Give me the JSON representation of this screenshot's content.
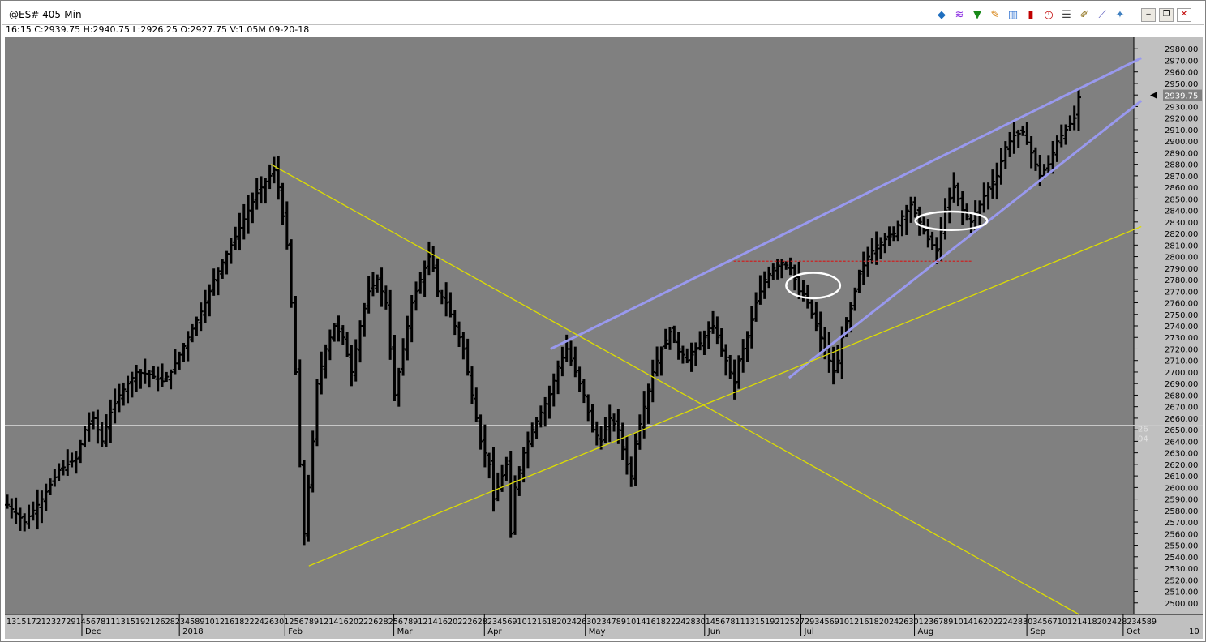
{
  "window": {
    "title": "@ES# 405-Min",
    "quote": "16:15  C:2939.75  H:2940.75  L:2926.25  O:2927.75  V:1.05M  09-20-18",
    "toolbar_icons": [
      "data-window-icon",
      "indicator-icon",
      "filter-icon",
      "drawing-pencil-icon",
      "bar-chart-icon",
      "candlestick-icon",
      "clock-icon",
      "format-icon",
      "pen-icon",
      "trendline-icon",
      "pin-icon"
    ],
    "toolbar_glyphs": [
      "◆",
      "≋",
      "▼",
      "✎",
      "▥",
      "▮",
      "◷",
      "☰",
      "✐",
      "⟋",
      "✦"
    ],
    "buttons": {
      "minimize": "‒",
      "restore": "❐",
      "close": "✕"
    }
  },
  "chart_data": {
    "type": "bar",
    "symbol": "@ES#",
    "interval": "405-Min",
    "ylim": [
      2490,
      2990
    ],
    "y_ticks": [
      "2980.00",
      "2970.00",
      "2960.00",
      "2950.00",
      "2940.00",
      "2930.00",
      "2920.00",
      "2910.00",
      "2900.00",
      "2890.00",
      "2880.00",
      "2870.00",
      "2860.00",
      "2850.00",
      "2840.00",
      "2830.00",
      "2820.00",
      "2810.00",
      "2800.00",
      "2790.00",
      "2780.00",
      "2770.00",
      "2760.00",
      "2750.00",
      "2740.00",
      "2730.00",
      "2720.00",
      "2710.00",
      "2700.00",
      "2690.00",
      "2680.00",
      "2670.00",
      "2660.00",
      "2650.00",
      "2640.00",
      "2630.00",
      "2620.00",
      "2610.00",
      "2600.00",
      "2590.00",
      "2580.00",
      "2570.00",
      "2560.00",
      "2550.00",
      "2540.00",
      "2530.00",
      "2520.00",
      "2510.00",
      "2500.00"
    ],
    "last_price_label": "2939.75",
    "crosshair_label_top": "26",
    "crosshair_label_bottom": "04",
    "crosshair_price": 2654,
    "x_day_ticks": "1315172123272914567811131519212628234589101216182224263012567891214162022262825678912141620222628234569101216182024263023478910141618222428301456781113151921252729345691012161820242630123678910141620222428303456710121418202428234589",
    "x_tail_ticks": "10",
    "month_labels": [
      "Dec",
      "2018",
      "Feb",
      "Mar",
      "Apr",
      "May",
      "Jun",
      "Jul",
      "Aug",
      "Sep",
      "Oct"
    ],
    "month_label_x_fracs": [
      0.07,
      0.155,
      0.247,
      0.342,
      0.421,
      0.509,
      0.613,
      0.697,
      0.796,
      0.894,
      0.978
    ],
    "bars_ohlc_anchor_path": [
      [
        0,
        2585
      ],
      [
        4,
        2570
      ],
      [
        8,
        2590
      ],
      [
        12,
        2615
      ],
      [
        16,
        2625
      ],
      [
        18,
        2650
      ],
      [
        20,
        2660
      ],
      [
        22,
        2640
      ],
      [
        24,
        2665
      ],
      [
        26,
        2680
      ],
      [
        28,
        2690
      ],
      [
        30,
        2700
      ],
      [
        33,
        2698
      ],
      [
        36,
        2692
      ],
      [
        38,
        2700
      ],
      [
        40,
        2715
      ],
      [
        42,
        2730
      ],
      [
        44,
        2745
      ],
      [
        46,
        2760
      ],
      [
        48,
        2780
      ],
      [
        50,
        2795
      ],
      [
        52,
        2810
      ],
      [
        54,
        2825
      ],
      [
        56,
        2840
      ],
      [
        58,
        2855
      ],
      [
        60,
        2865
      ],
      [
        62,
        2875
      ],
      [
        63,
        2860
      ],
      [
        64,
        2835
      ],
      [
        65,
        2810
      ],
      [
        66,
        2760
      ],
      [
        67,
        2700
      ],
      [
        68,
        2620
      ],
      [
        69,
        2560
      ],
      [
        70,
        2600
      ],
      [
        71,
        2640
      ],
      [
        72,
        2690
      ],
      [
        74,
        2720
      ],
      [
        76,
        2740
      ],
      [
        78,
        2730
      ],
      [
        80,
        2700
      ],
      [
        82,
        2740
      ],
      [
        84,
        2770
      ],
      [
        86,
        2780
      ],
      [
        88,
        2760
      ],
      [
        90,
        2680
      ],
      [
        92,
        2720
      ],
      [
        94,
        2760
      ],
      [
        96,
        2780
      ],
      [
        98,
        2800
      ],
      [
        99,
        2790
      ],
      [
        100,
        2770
      ],
      [
        102,
        2760
      ],
      [
        104,
        2740
      ],
      [
        106,
        2720
      ],
      [
        108,
        2680
      ],
      [
        110,
        2640
      ],
      [
        112,
        2620
      ],
      [
        113,
        2590
      ],
      [
        114,
        2600
      ],
      [
        116,
        2620
      ],
      [
        117,
        2560
      ],
      [
        118,
        2600
      ],
      [
        120,
        2630
      ],
      [
        122,
        2650
      ],
      [
        124,
        2665
      ],
      [
        126,
        2680
      ],
      [
        128,
        2705
      ],
      [
        130,
        2720
      ],
      [
        132,
        2700
      ],
      [
        134,
        2680
      ],
      [
        136,
        2650
      ],
      [
        138,
        2640
      ],
      [
        140,
        2660
      ],
      [
        142,
        2650
      ],
      [
        144,
        2620
      ],
      [
        145,
        2610
      ],
      [
        146,
        2640
      ],
      [
        148,
        2670
      ],
      [
        150,
        2700
      ],
      [
        152,
        2720
      ],
      [
        154,
        2735
      ],
      [
        156,
        2720
      ],
      [
        158,
        2710
      ],
      [
        160,
        2720
      ],
      [
        162,
        2730
      ],
      [
        164,
        2740
      ],
      [
        166,
        2720
      ],
      [
        168,
        2700
      ],
      [
        169,
        2690
      ],
      [
        170,
        2710
      ],
      [
        172,
        2730
      ],
      [
        174,
        2760
      ],
      [
        176,
        2780
      ],
      [
        178,
        2790
      ],
      [
        180,
        2795
      ],
      [
        182,
        2790
      ],
      [
        184,
        2770
      ],
      [
        186,
        2760
      ],
      [
        188,
        2740
      ],
      [
        190,
        2720
      ],
      [
        192,
        2700
      ],
      [
        193,
        2710
      ],
      [
        194,
        2730
      ],
      [
        196,
        2755
      ],
      [
        198,
        2785
      ],
      [
        200,
        2800
      ],
      [
        202,
        2810
      ],
      [
        204,
        2815
      ],
      [
        206,
        2820
      ],
      [
        208,
        2835
      ],
      [
        210,
        2845
      ],
      [
        212,
        2830
      ],
      [
        214,
        2815
      ],
      [
        216,
        2805
      ],
      [
        218,
        2840
      ],
      [
        220,
        2860
      ],
      [
        222,
        2840
      ],
      [
        224,
        2830
      ],
      [
        226,
        2845
      ],
      [
        228,
        2860
      ],
      [
        230,
        2870
      ],
      [
        232,
        2895
      ],
      [
        234,
        2905
      ],
      [
        236,
        2908
      ],
      [
        238,
        2890
      ],
      [
        240,
        2870
      ],
      [
        242,
        2880
      ],
      [
        244,
        2900
      ],
      [
        246,
        2910
      ],
      [
        248,
        2920
      ],
      [
        249,
        2938
      ]
    ],
    "trendlines": [
      {
        "id": "upper-channel",
        "color": "#9999ee",
        "points": [
          [
            "2018-04-20",
            2720
          ],
          [
            "2018-10-08",
            2972
          ]
        ]
      },
      {
        "id": "lower-channel",
        "color": "#9999ee",
        "points": [
          [
            "2018-06-28",
            2695
          ],
          [
            "2018-10-08",
            2935
          ]
        ]
      },
      {
        "id": "long-support",
        "color": "#dddd00",
        "points": [
          [
            "2018-02-09",
            2532
          ],
          [
            "2018-10-08",
            2826
          ]
        ]
      },
      {
        "id": "downtrend",
        "color": "#dddd00",
        "points": [
          [
            "2018-01-29",
            2880
          ],
          [
            "2018-09-20",
            2490
          ]
        ]
      },
      {
        "id": "resistance-dash",
        "color": "#cc2222",
        "points": [
          [
            "2018-06-12",
            2796
          ],
          [
            "2018-08-20",
            2796
          ]
        ]
      }
    ],
    "ellipses": [
      {
        "id": "gap-july",
        "center": [
          "2018-07-05",
          2775
        ],
        "rx_days": 3,
        "ry_pts": 11
      },
      {
        "id": "pullback-aug",
        "center": [
          "2018-08-14",
          2831
        ],
        "rx_days": 4,
        "ry_pts": 8
      }
    ],
    "colors": {
      "plot_bg": "#808080",
      "axis_bg": "#c0c0c0",
      "bars": "#000000",
      "crosshair": "#c8c8c8"
    }
  }
}
